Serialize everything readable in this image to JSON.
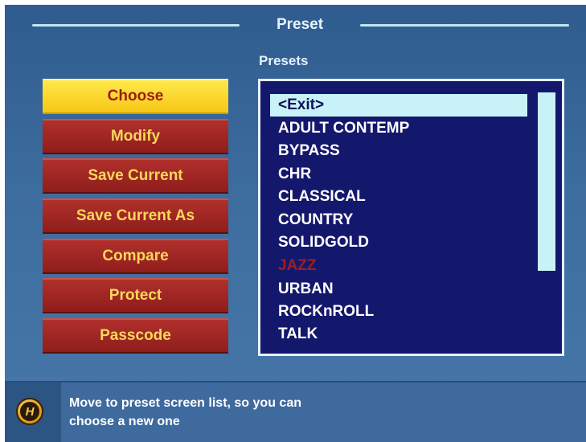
{
  "header": {
    "title": "Preset",
    "presets_label": "Presets"
  },
  "menu": {
    "items": [
      {
        "label": "Choose",
        "selected": true
      },
      {
        "label": "Modify"
      },
      {
        "label": "Save Current"
      },
      {
        "label": "Save Current As"
      },
      {
        "label": "Compare"
      },
      {
        "label": "Protect"
      },
      {
        "label": "Passcode"
      }
    ]
  },
  "presets": {
    "items": [
      {
        "label": "<Exit>",
        "state": "highlighted"
      },
      {
        "label": "ADULT CONTEMP"
      },
      {
        "label": "BYPASS"
      },
      {
        "label": "CHR"
      },
      {
        "label": "CLASSICAL"
      },
      {
        "label": "COUNTRY"
      },
      {
        "label": "SOLIDGOLD"
      },
      {
        "label": "JAZZ",
        "state": "disabled"
      },
      {
        "label": "URBAN"
      },
      {
        "label": "ROCKnROLL"
      },
      {
        "label": "TALK"
      }
    ]
  },
  "help": {
    "icon": "help-h-icon",
    "icon_glyph": "H",
    "line1": "Move to preset screen list, so you can",
    "line2": "choose a new one"
  },
  "colors": {
    "selected_button": "#f7c716",
    "button": "#a0231f",
    "button_text": "#f8d75a",
    "list_background": "#14186d",
    "list_highlight": "#c8f2f8",
    "disabled_item": "#9e1e24"
  }
}
